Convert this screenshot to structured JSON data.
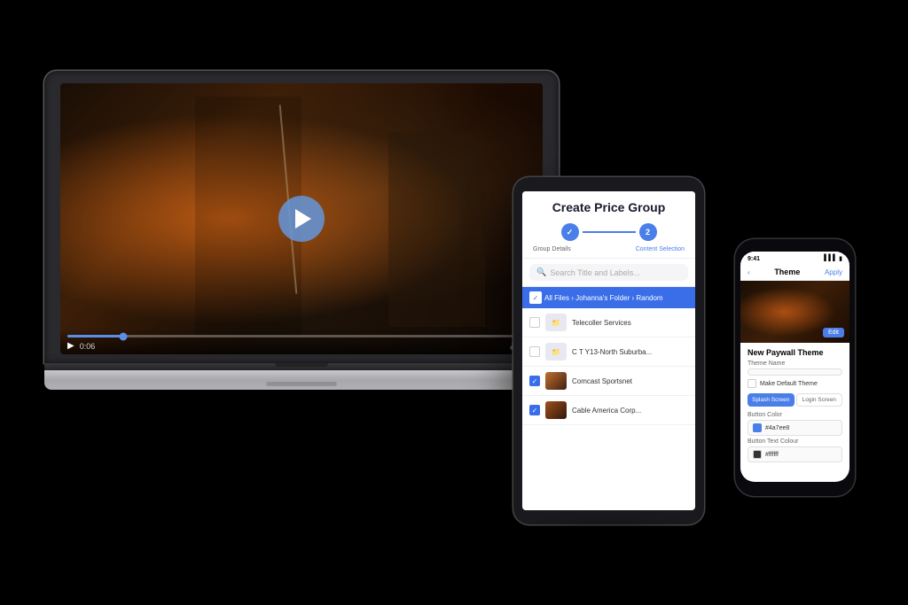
{
  "scene": {
    "bg": "#000000"
  },
  "laptop": {
    "video": {
      "play_label": "▶",
      "time": "0:06",
      "time_full": "0:06"
    }
  },
  "tablet": {
    "title": "Create Price Group",
    "step1_label": "Group Details",
    "step2_label": "Content Selection",
    "search_placeholder": "Search Title and Labels...",
    "breadcrumb": "All Files › Johanna's Folder › Random",
    "files": [
      {
        "name": "Telecoller Services",
        "type": "folder",
        "checked": false
      },
      {
        "name": "C T Y13-North Suburba...",
        "type": "folder",
        "checked": false
      },
      {
        "name": "Comcast Sportsnet",
        "type": "video",
        "checked": true
      },
      {
        "name": "Cable America Corp...",
        "type": "video",
        "checked": true
      }
    ]
  },
  "phone": {
    "time": "9:41",
    "back_label": "‹",
    "title": "Theme",
    "action_label": "Apply",
    "section_title": "New Paywall Theme",
    "field_theme_label": "Theme Name",
    "field_theme_placeholder": "",
    "checkbox_label": "Make Default Theme",
    "tab_splash": "Splash Screen",
    "tab_login": "Login Screen",
    "button_color_label": "Button Color",
    "button_color_value": "#4a7ee8",
    "button_text_label": "Button Text Colour",
    "button_text_value": "#ffffff"
  }
}
